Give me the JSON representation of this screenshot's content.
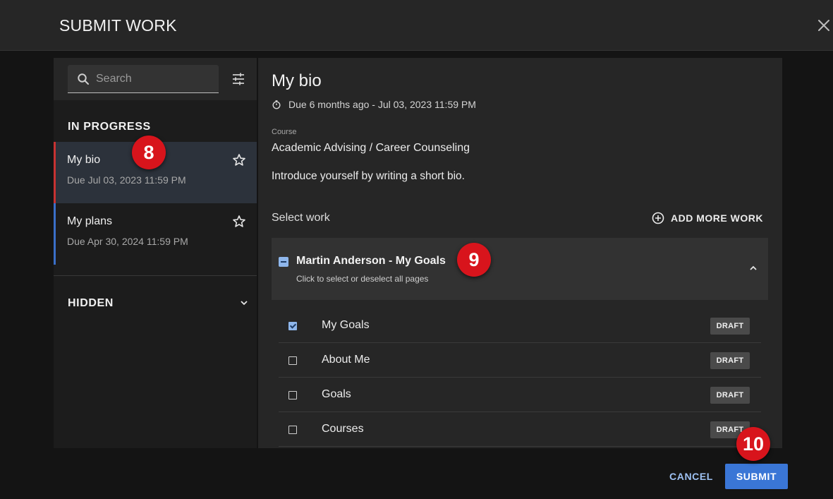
{
  "dialog": {
    "title": "SUBMIT WORK"
  },
  "search": {
    "placeholder": "Search"
  },
  "sidebar": {
    "in_progress_label": "IN PROGRESS",
    "hidden_label": "HIDDEN",
    "assignments": [
      {
        "name": "My bio",
        "due": "Due Jul 03, 2023 11:59 PM",
        "active": true
      },
      {
        "name": "My plans",
        "due": "Due Apr 30, 2024 11:59 PM",
        "active": false
      }
    ]
  },
  "detail": {
    "title": "My bio",
    "due": "Due 6 months ago - Jul 03, 2023 11:59 PM",
    "course_label": "Course",
    "course": "Academic Advising / Career Counseling",
    "description": "Introduce yourself by writing a short bio.",
    "select_work_label": "Select work",
    "add_more_label": "ADD MORE WORK",
    "group": {
      "name": "Martin Anderson - My Goals",
      "hint": "Click to select or deselect all pages",
      "pages": [
        {
          "name": "My Goals",
          "status": "DRAFT",
          "checked": true
        },
        {
          "name": "About Me",
          "status": "DRAFT",
          "checked": false
        },
        {
          "name": "Goals",
          "status": "DRAFT",
          "checked": false
        },
        {
          "name": "Courses",
          "status": "DRAFT",
          "checked": false
        }
      ]
    }
  },
  "footer": {
    "cancel_label": "CANCEL",
    "submit_label": "SUBMIT"
  },
  "markers": [
    "8",
    "9",
    "10"
  ],
  "colors": {
    "accent": "#3a76d6",
    "active_bar": "#c73232",
    "marker": "#d8141c"
  }
}
